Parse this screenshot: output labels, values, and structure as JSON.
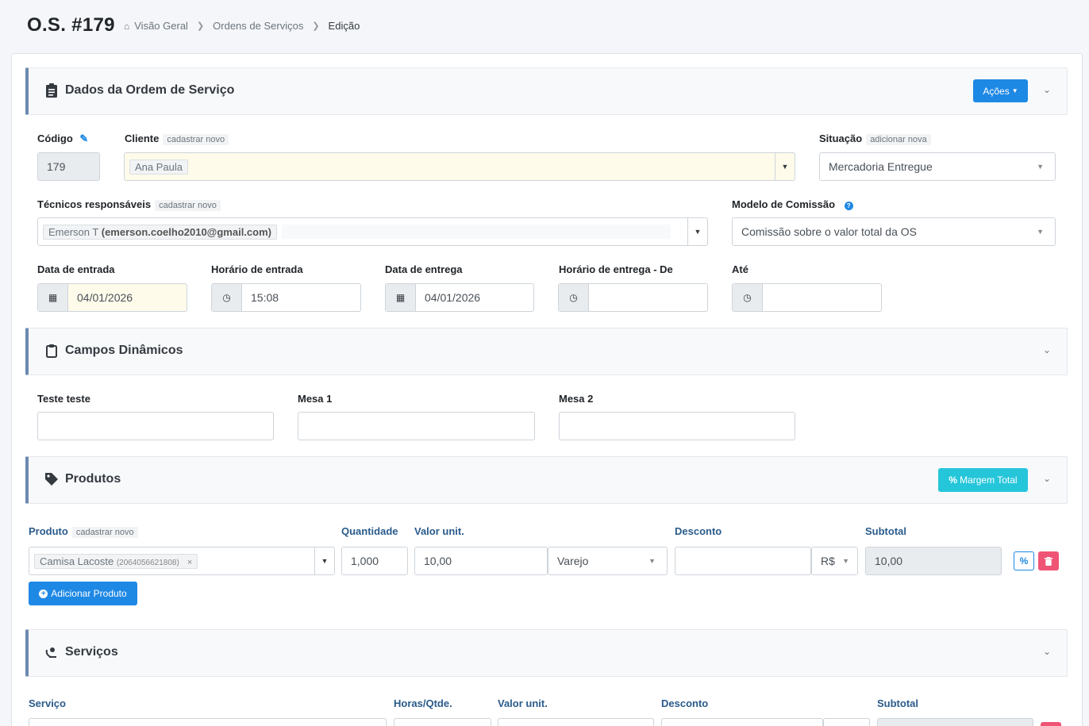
{
  "header": {
    "title": "O.S. #179",
    "breadcrumb": [
      "Visão Geral",
      "Ordens de Serviços",
      "Edição"
    ]
  },
  "sections": {
    "dados": {
      "title": "Dados da Ordem de Serviço",
      "actions_label": "Ações"
    },
    "campos": {
      "title": "Campos Dinâmicos"
    },
    "produtos": {
      "title": "Produtos",
      "margin_label": "Margem Total"
    },
    "servicos": {
      "title": "Serviços"
    }
  },
  "form": {
    "codigo": {
      "label": "Código",
      "value": "179"
    },
    "cliente": {
      "label": "Cliente",
      "tag": "cadastrar novo",
      "value": "Ana Paula"
    },
    "situacao": {
      "label": "Situação",
      "tag": "adicionar nova",
      "value": "Mercadoria Entregue"
    },
    "tecnicos": {
      "label": "Técnicos responsáveis",
      "tag": "cadastrar novo",
      "name": "Emerson T",
      "email": "(emerson.coelho2010@gmail.com)"
    },
    "comissao": {
      "label": "Modelo de Comissão",
      "value": "Comissão sobre o valor total da OS"
    },
    "data_entrada": {
      "label": "Data de entrada",
      "value": "04/01/2026"
    },
    "horario_entrada": {
      "label": "Horário de entrada",
      "value": "15:08"
    },
    "data_entrega": {
      "label": "Data de entrega",
      "value": "04/01/2026"
    },
    "horario_entrega_de": {
      "label": "Horário de entrega - De",
      "value": ""
    },
    "ate": {
      "label": "Até",
      "value": ""
    }
  },
  "dynamic_fields": [
    {
      "label": "Teste teste",
      "value": ""
    },
    {
      "label": "Mesa 1",
      "value": ""
    },
    {
      "label": "Mesa 2",
      "value": ""
    }
  ],
  "produtos": {
    "labels": {
      "produto": "Produto",
      "tag": "cadastrar novo",
      "quantidade": "Quantidade",
      "valor_unit": "Valor unit.",
      "desconto": "Desconto",
      "subtotal": "Subtotal"
    },
    "row": {
      "produto": "Camisa Lacoste",
      "codigo": "(2064056621808)",
      "quantidade": "1,000",
      "valor_unit": "10,00",
      "tabela": "Varejo",
      "desconto": "",
      "moeda": "R$",
      "subtotal": "10,00"
    },
    "add_label": "Adicionar Produto"
  },
  "servicos": {
    "labels": {
      "servico": "Serviço",
      "horas": "Horas/Qtde.",
      "valor_unit": "Valor unit.",
      "desconto": "Desconto",
      "subtotal": "Subtotal"
    }
  },
  "colors": {
    "primary": "#1e88e5",
    "cyan": "#26c6da",
    "danger": "#ef5475",
    "accent_border": "#6c8ab0"
  }
}
